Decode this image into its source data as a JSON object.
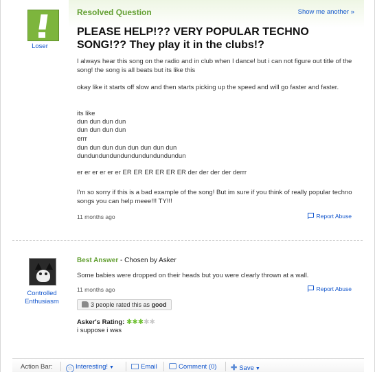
{
  "question": {
    "status": "Resolved Question",
    "show_another": "Show me another »",
    "asker": "Loser",
    "title": "PLEASE HELP!?? VERY POPULAR TECHNO SONG!?? They play it in the clubs!?",
    "paragraphs": [
      "I always hear this song on the radio and in club when I dance! but i can not figure out title of the song! the song is all beats but its like this",
      "okay like it starts off slow and then starts picking up the speed and will go faster and faster.",
      "its like",
      "dun dun dun dun",
      "dun dun dun dun",
      "errr",
      "dun dun dun dun dun dun dun dun",
      "dundundundundundundundundundun",
      "er er er er er er ER ER ER ER ER ER der der der der derrr",
      "I'm so sorry if this is a bad example of the song! But im sure if you think of really popular techno songs you can help meee!!! TY!!!"
    ],
    "timestamp": "11 months ago",
    "report_abuse": "Report Abuse"
  },
  "answer": {
    "answerer": [
      "Controlled",
      "Enthusiasm"
    ],
    "label": "Best Answer",
    "chosen_by": " - Chosen by Asker",
    "text": "Some babies were dropped on their heads but you were clearly thrown at a wall.",
    "timestamp": "11 months ago",
    "report_abuse": "Report Abuse",
    "rated_prefix": "3 people rated this as ",
    "rated_value": "good",
    "askers_rating_label": "Asker's Rating:",
    "rating_stars": 3,
    "rating_max": 5,
    "comment": "i suppose i was"
  },
  "action_bar": {
    "label": "Action Bar:",
    "interesting": "Interesting!",
    "email": "Email",
    "comment": "Comment (0)",
    "save": "Save"
  },
  "colors": {
    "accent_green": "#64a034",
    "link_blue": "#1155cc",
    "logo_green": "#7db53d"
  }
}
